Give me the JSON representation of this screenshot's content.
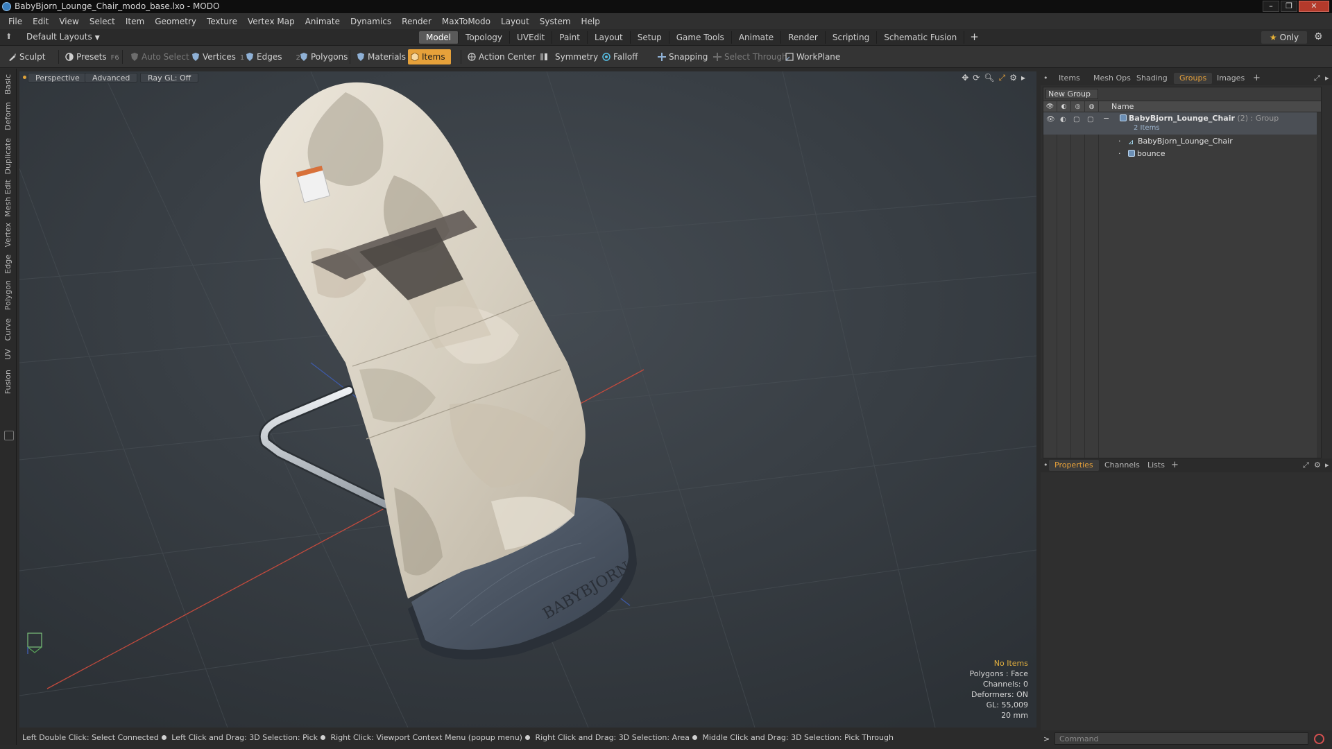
{
  "window": {
    "title": "BabyBjorn_Lounge_Chair_modo_base.lxo - MODO",
    "buttons": [
      "–",
      "❐",
      "✕"
    ]
  },
  "menu": [
    "File",
    "Edit",
    "View",
    "Select",
    "Item",
    "Geometry",
    "Texture",
    "Vertex Map",
    "Animate",
    "Dynamics",
    "Render",
    "MaxToModo",
    "Layout",
    "System",
    "Help"
  ],
  "layout": {
    "selector": "Default Layouts",
    "tabs": [
      "Model",
      "Topology",
      "UVEdit",
      "Paint",
      "Layout",
      "Setup",
      "Game Tools",
      "Animate",
      "Render",
      "Scripting",
      "Schematic Fusion"
    ],
    "active_tab": "Model",
    "add": "+",
    "only_label": "Only"
  },
  "toolbar": {
    "sculpt": "Sculpt",
    "presets": "Presets",
    "presets_key": "F6",
    "auto_select": "Auto Select",
    "vertices": "Vertices",
    "vertices_key": "1",
    "edges": "Edges",
    "edges_key": "2",
    "polygons": "Polygons",
    "materials": "Materials",
    "items": "Items",
    "action_center": "Action Center",
    "symmetry": "Symmetry",
    "falloff": "Falloff",
    "snapping": "Snapping",
    "select_through": "Select Through",
    "workplane": "WorkPlane"
  },
  "left_tabs": [
    "Basic",
    "Deform",
    "Duplicate",
    "Mesh Edit",
    "Vertex",
    "Edge",
    "Polygon",
    "Curve",
    "UV",
    "Fusion"
  ],
  "viewport": {
    "view": "Perspective",
    "shading": "Advanced",
    "raygl": "Ray GL: Off",
    "info": {
      "no_items": "No Items",
      "polygons": "Polygons : Face",
      "channels": "Channels: 0",
      "deformers": "Deformers: ON",
      "gl": "GL: 55,009",
      "scale": "20 mm"
    },
    "logo_text": "BABYBJORN"
  },
  "status": [
    "Left Double Click: Select Connected",
    "Left Click and Drag: 3D Selection: Pick",
    "Right Click: Viewport Context Menu (popup menu)",
    "Right Click and Drag: 3D Selection: Area",
    "Middle Click and Drag: 3D Selection: Pick Through"
  ],
  "top_panel": {
    "tabs": [
      "Items",
      "Mesh Ops",
      "Shading",
      "Groups",
      "Images"
    ],
    "active": "Groups",
    "new_group": "New Group",
    "name_header": "Name",
    "group": {
      "name": "BabyBjorn_Lounge_Chair",
      "count": "(2)",
      "type": ": Group",
      "sub": "2 Items",
      "children": [
        "BabyBjorn_Lounge_Chair",
        "bounce"
      ]
    }
  },
  "bottom_panel": {
    "tabs": [
      "Properties",
      "Channels",
      "Lists"
    ],
    "active": "Properties"
  },
  "command": {
    "placeholder": "Command"
  },
  "colors": {
    "accent": "#e6a13a",
    "viewport_bg": "#363c42",
    "seat_fabric": "#d9d2c4",
    "base": "#4e5866",
    "x_axis": "#c34a3d",
    "z_axis": "#3e5aa6"
  }
}
